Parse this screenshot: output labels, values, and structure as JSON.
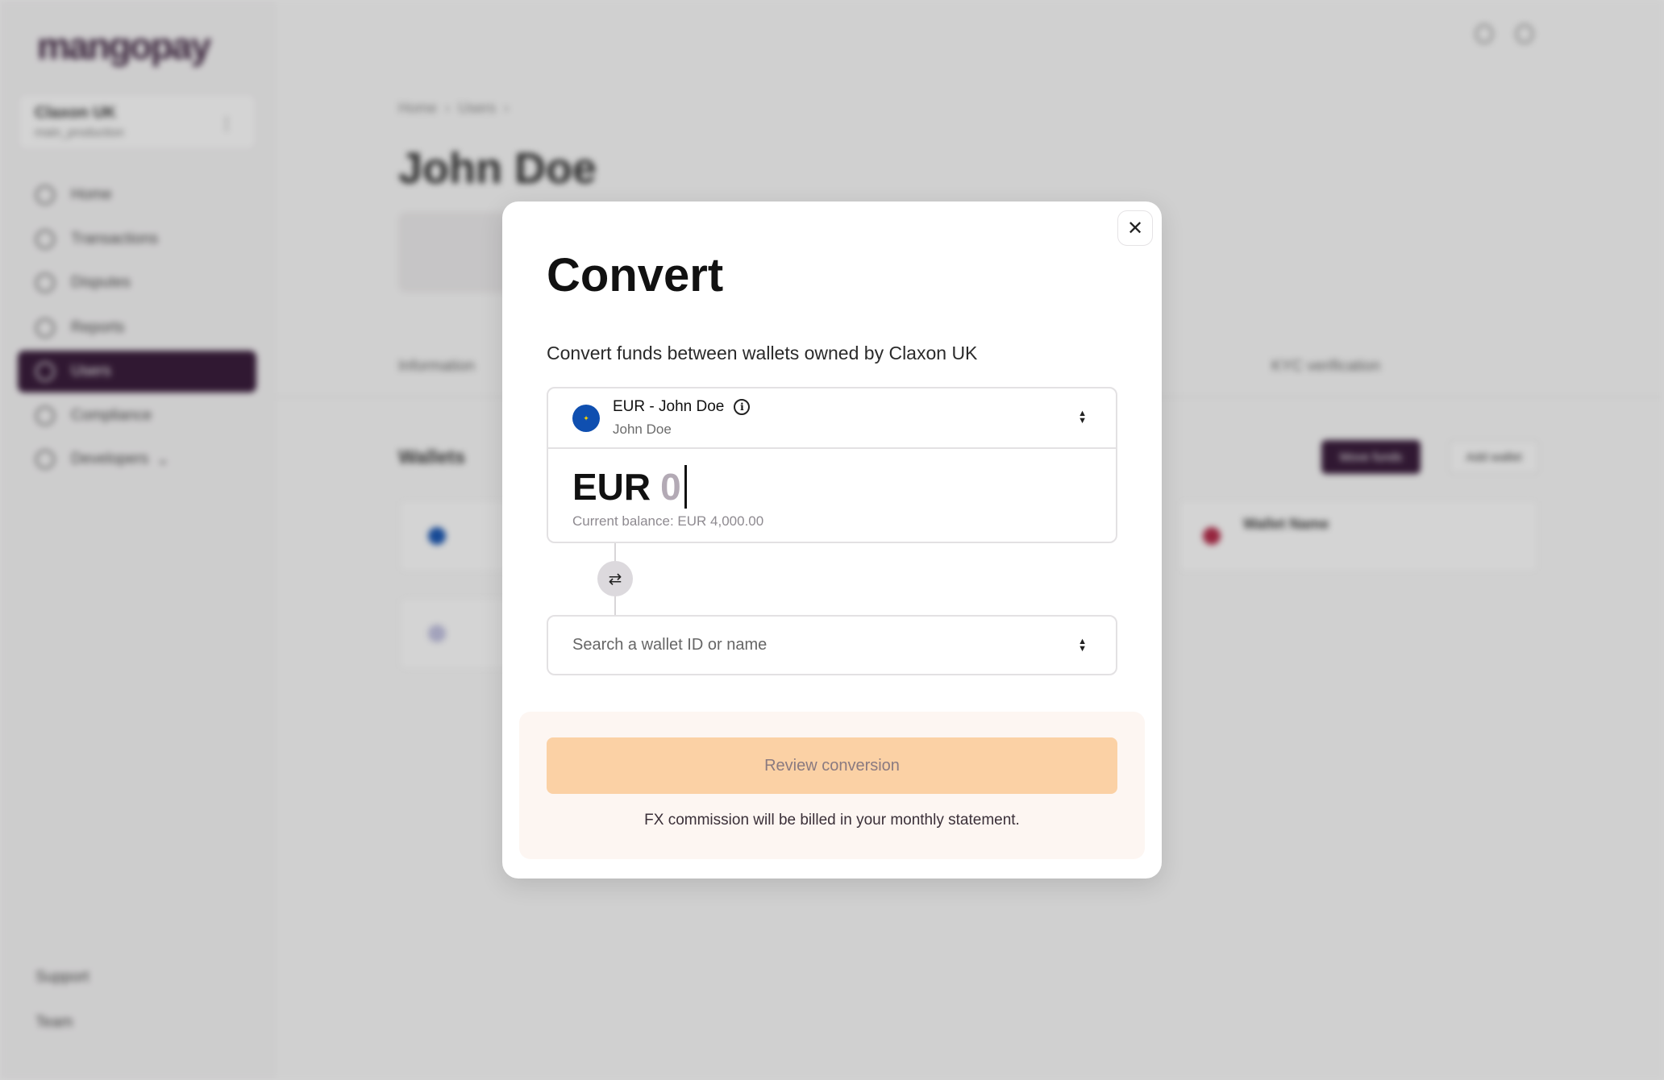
{
  "background": {
    "logo": "mangopay",
    "org": {
      "name": "Claxon UK",
      "env": "main_production"
    },
    "nav": [
      {
        "label": "Home",
        "icon": "home-icon"
      },
      {
        "label": "Transactions",
        "icon": "transactions-icon"
      },
      {
        "label": "Disputes",
        "icon": "disputes-icon"
      },
      {
        "label": "Reports",
        "icon": "reports-icon"
      },
      {
        "label": "Users",
        "icon": "users-icon",
        "active": true
      },
      {
        "label": "Compliance",
        "icon": "compliance-icon"
      },
      {
        "label": "Developers",
        "icon": "code-icon"
      }
    ],
    "footer_nav": [
      "Support",
      "Team"
    ],
    "breadcrumb": [
      "Home",
      "Users"
    ],
    "page_title": "John Doe",
    "tabs": [
      "Information",
      "KYC verification"
    ],
    "wallets_heading": "Wallets",
    "move_funds": "Move funds",
    "add_wallet": "Add wallet",
    "wallet_name": "Wallet Name"
  },
  "modal": {
    "title": "Convert",
    "subtitle": "Convert funds between wallets owned by Claxon UK",
    "source": {
      "wallet_label": "EUR - John Doe",
      "owner": "John Doe",
      "currency": "EUR",
      "amount": "0",
      "balance": "Current balance: EUR 4,000.00"
    },
    "target": {
      "placeholder": "Search a wallet ID or name"
    },
    "review_button": "Review conversion",
    "fx_note": "FX commission will be billed in your monthly statement.",
    "colors": {
      "primary": "#2e0f30",
      "review_button": "#fbd1a5",
      "panel": "#fdf6f2",
      "eu_flag": "#0f4fb0"
    }
  }
}
